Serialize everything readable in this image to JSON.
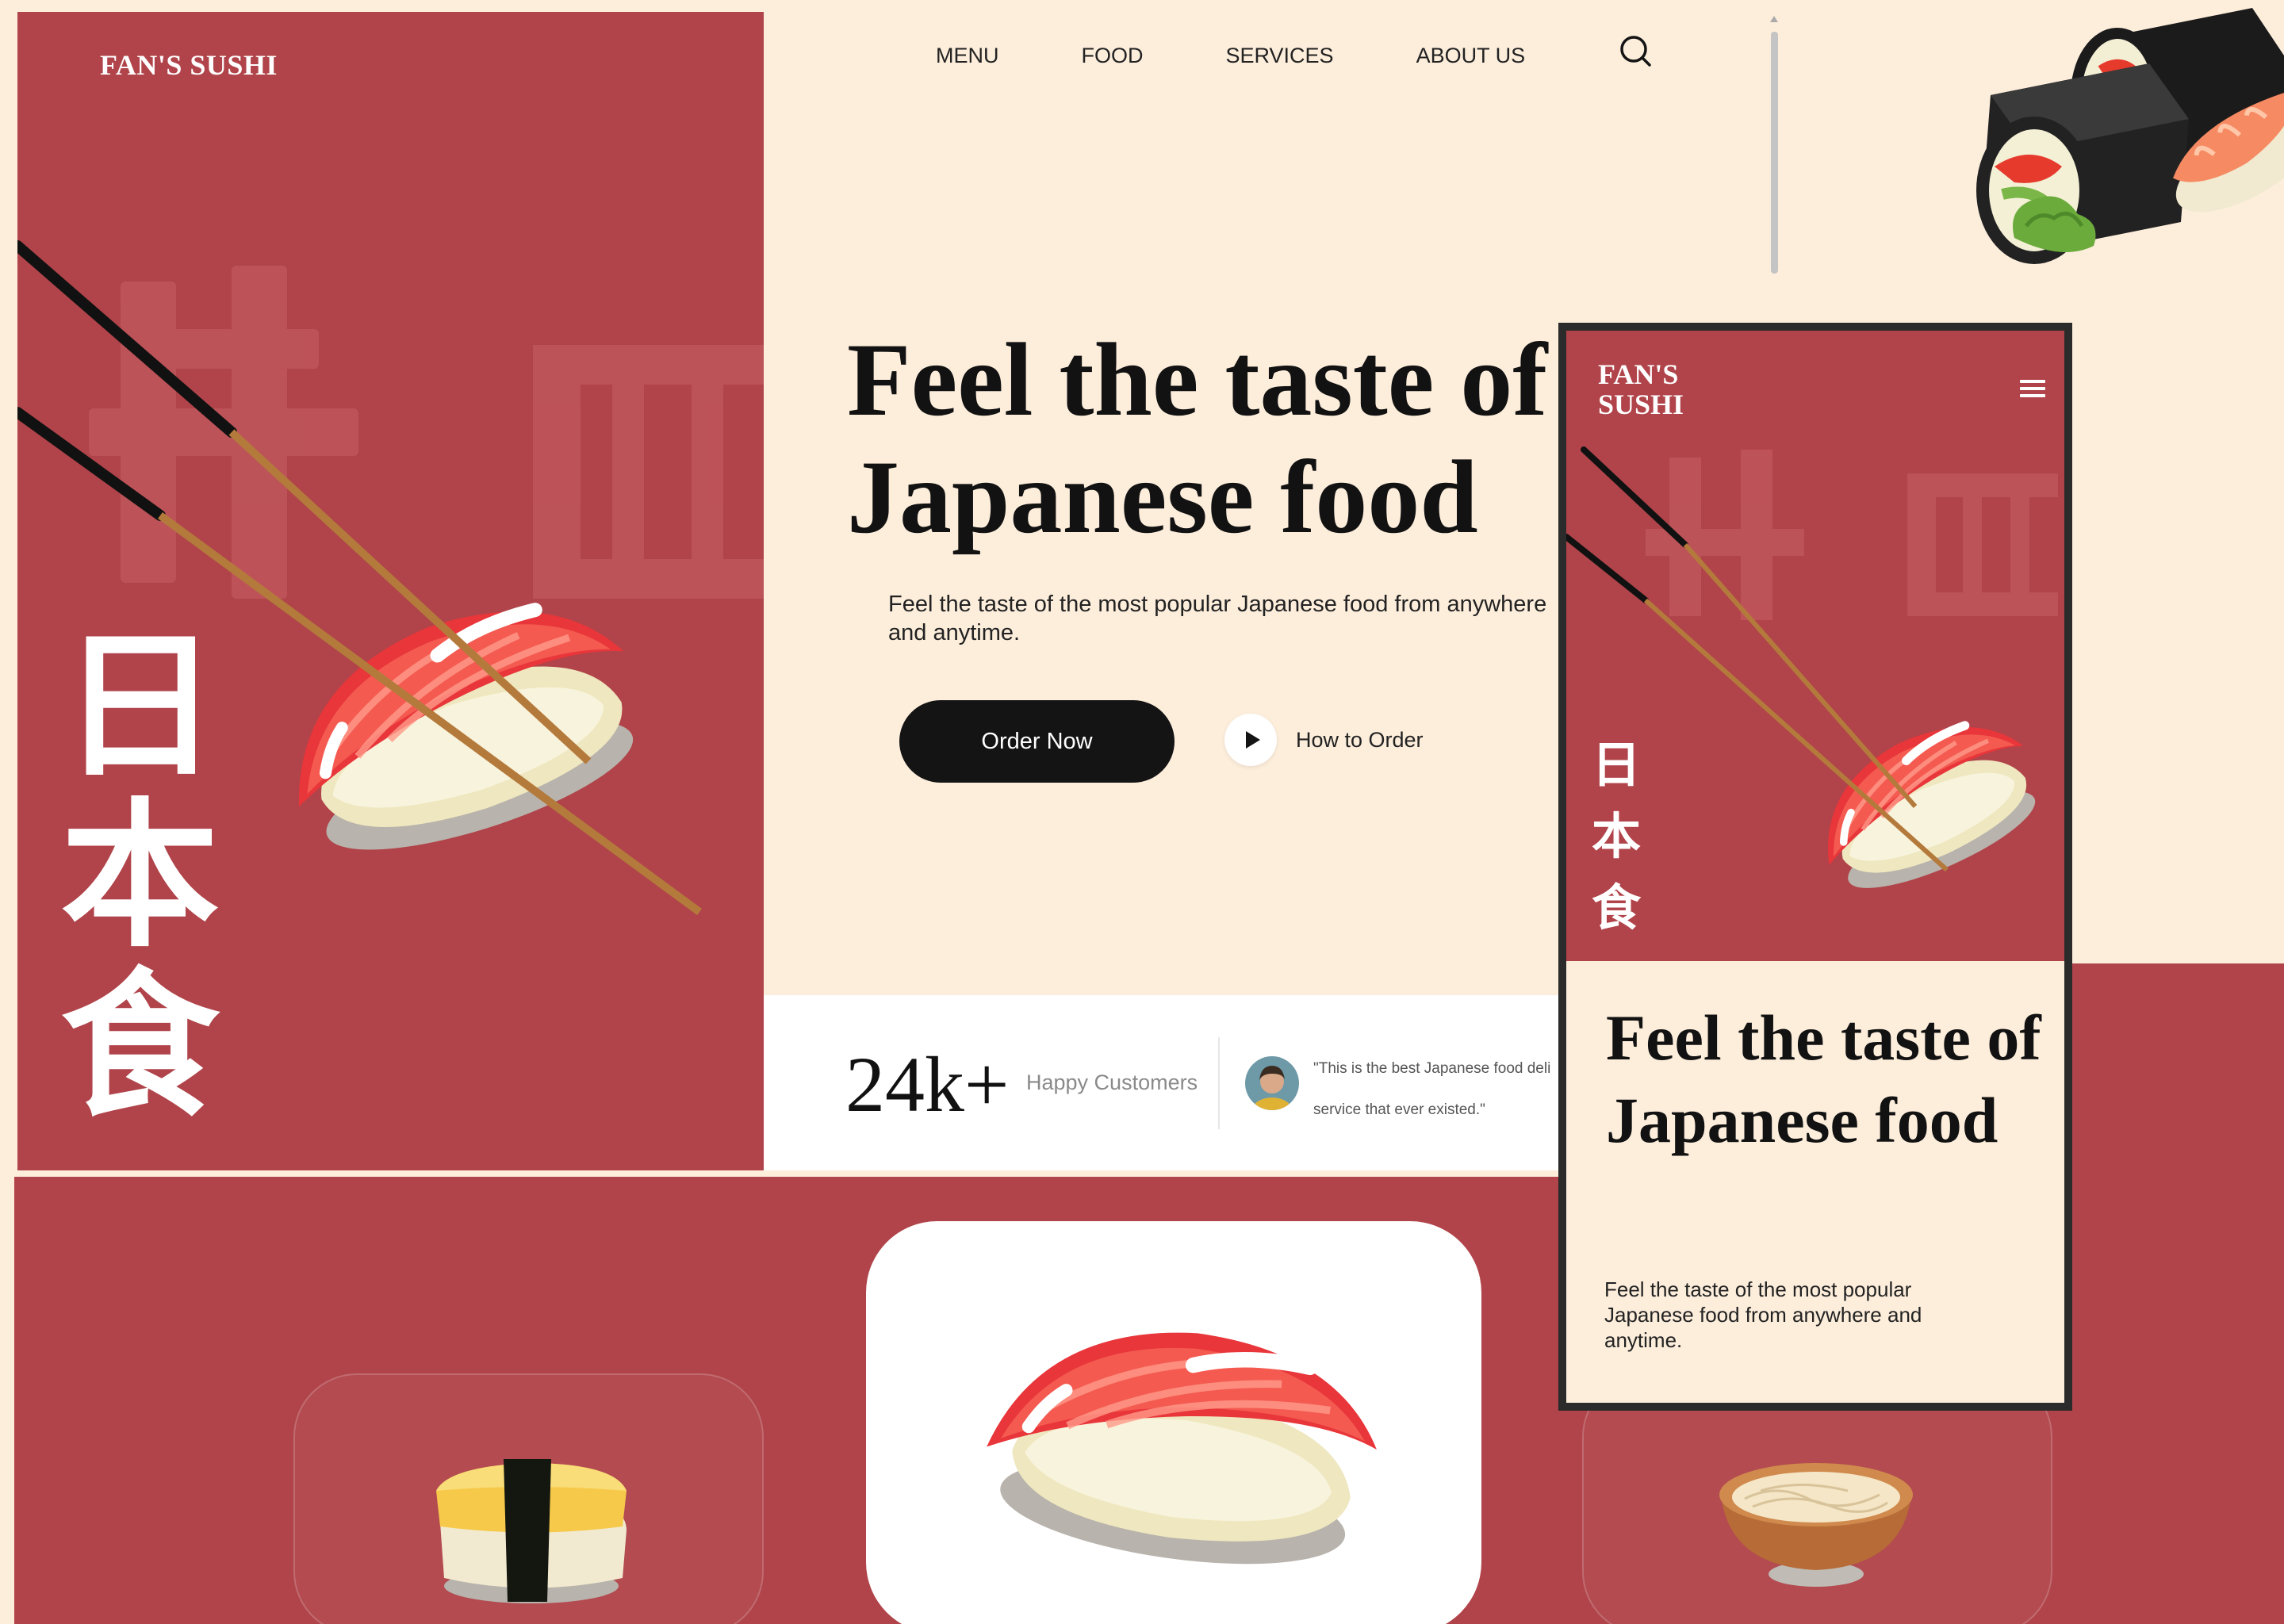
{
  "brand": "FAN'S SUSHI",
  "mobile_brand_lines": [
    "FAN'S",
    "SUSHI"
  ],
  "kanji": [
    "日",
    "本",
    "食"
  ],
  "nav": {
    "items": [
      "MENU",
      "FOOD",
      "SERVICES",
      "ABOUT US"
    ],
    "search_icon": "search-icon"
  },
  "hero": {
    "title": "Feel the taste of Japanese food",
    "subtitle": "Feel the taste of the most popular Japanese food from anywhere and anytime.",
    "order_button": "Order Now",
    "how_to_order": "How to Order"
  },
  "stats": {
    "count": "24k+",
    "count_label": "Happy Customers",
    "quote": "\"This is the best Japanese food delivery service that ever existed.\"",
    "quote_line_1": "\"This is the best Japanese food deli",
    "quote_line_2": "service that ever existed.\""
  },
  "mobile": {
    "title": "Feel the taste of Japanese food",
    "subtitle": "Feel the taste of the most popular Japanese food from anywhere and anytime.",
    "menu_icon": "hamburger-icon"
  },
  "colors": {
    "brand_red": "#b0444a",
    "cream": "#fdeedc",
    "dark": "#141414",
    "white": "#ffffff"
  },
  "food_cards": {
    "items": [
      "tamago-nigiri",
      "salmon-nigiri",
      "noodle-bowl"
    ]
  }
}
